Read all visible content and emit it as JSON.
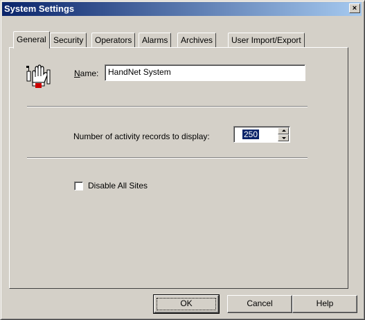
{
  "window": {
    "title": "System Settings",
    "close_label": "×"
  },
  "tabs": [
    {
      "label": "General",
      "active": true
    },
    {
      "label": "Security",
      "active": false
    },
    {
      "label": "Operators",
      "active": false
    },
    {
      "label": "Alarms",
      "active": false
    },
    {
      "label": "Archives",
      "active": false
    },
    {
      "label": "User Import/Export",
      "active": false
    }
  ],
  "general": {
    "icon": "hand-reader-icon",
    "name_label_underlined": "N",
    "name_label_rest": "ame:",
    "name_value": "HandNet System",
    "records_label": "Number of activity records to display:",
    "records_value": "250",
    "disable_sites_label": "Disable All Sites",
    "disable_sites_checked": false
  },
  "buttons": {
    "ok": "OK",
    "cancel": "Cancel",
    "help": "Help"
  }
}
